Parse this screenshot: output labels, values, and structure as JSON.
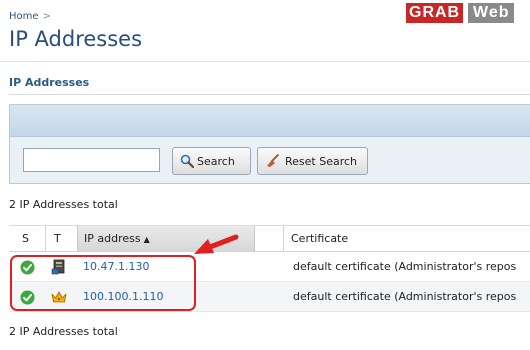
{
  "breadcrumb": {
    "home": "Home",
    "separator": ">"
  },
  "page": {
    "title": "IP Addresses"
  },
  "logo": {
    "part1": "GRAB",
    "part2": "Web"
  },
  "section": {
    "title": "IP Addresses"
  },
  "search": {
    "value": "",
    "placeholder": "",
    "search_label": "Search",
    "reset_label": "Reset Search"
  },
  "totals": {
    "top": "2 IP Addresses total",
    "bottom": "2 IP Addresses total"
  },
  "table": {
    "columns": {
      "status": "S",
      "type": "T",
      "ip": "IP address",
      "ip_sort_icon": "sort-ascending-icon",
      "certificate": "Certificate"
    },
    "rows": [
      {
        "status_icon": "ok-check-icon",
        "type_icon": "server-shared-icon",
        "ip": "10.47.1.130",
        "certificate": "default certificate (Administrator's repos"
      },
      {
        "status_icon": "ok-check-icon",
        "type_icon": "crown-dedicated-icon",
        "ip": "100.100.1.110",
        "certificate": "default certificate (Administrator's repos"
      }
    ]
  },
  "colors": {
    "title": "#2a4d7a",
    "link": "#2360a8",
    "highlight": "#e02020",
    "ok": "#3aa83a",
    "logo_red": "#c62828",
    "logo_gray": "#8a8a8a"
  }
}
